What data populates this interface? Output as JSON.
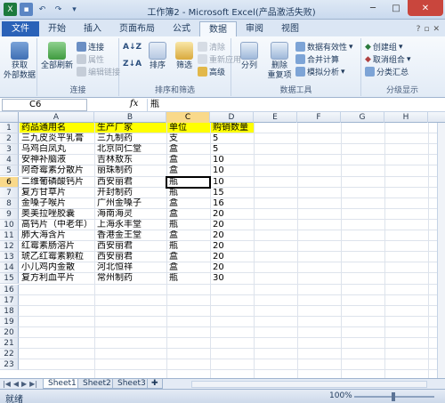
{
  "window": {
    "title": "工作簿2 - Microsoft Excel(产品激活失败)"
  },
  "tabs": [
    {
      "label": "文件"
    },
    {
      "label": "开始"
    },
    {
      "label": "插入"
    },
    {
      "label": "页面布局"
    },
    {
      "label": "公式"
    },
    {
      "label": "数据"
    },
    {
      "label": "审阅"
    },
    {
      "label": "视图"
    }
  ],
  "ribbon": {
    "get_external": "获取\n外部数据",
    "refresh_all": "全部刷新",
    "connections": "连接",
    "properties": "属性",
    "edit_links": "编辑链接",
    "group_connections": "连接",
    "sort_az": "A↓Z",
    "sort_za": "Z↓A",
    "sort": "排序",
    "filter": "筛选",
    "clear": "清除",
    "reapply": "重新应用",
    "advanced": "高级",
    "group_sort": "排序和筛选",
    "text_to_columns": "分列",
    "remove_dupes": "删除\n重复项",
    "data_validation": "数据有效性",
    "consolidate": "合并计算",
    "what_if": "模拟分析",
    "group_tools": "数据工具",
    "group_create": "创建组",
    "ungroup": "取消组合",
    "subtotal": "分类汇总",
    "group_outline": "分级显示"
  },
  "formula_bar": {
    "name_box": "C6",
    "fx": "fx",
    "formula": "瓶"
  },
  "columns": [
    "A",
    "B",
    "C",
    "D",
    "E",
    "F",
    "G",
    "H"
  ],
  "rows": [
    "1",
    "2",
    "3",
    "4",
    "5",
    "6",
    "7",
    "8",
    "9",
    "10",
    "11",
    "12",
    "13",
    "14",
    "15",
    "16",
    "17",
    "18",
    "19",
    "20",
    "21",
    "22",
    "23"
  ],
  "sheet": {
    "header": [
      "药品通用名",
      "生产厂家",
      "单位",
      "购销数量"
    ],
    "data": [
      [
        "三九皮炎平乳膏",
        "三九制药",
        "支",
        "5"
      ],
      [
        "乌鸡白凤丸",
        "北京同仁堂",
        "盒",
        "5"
      ],
      [
        "安神补脑液",
        "吉林敖东",
        "盒",
        "10"
      ],
      [
        "阿奇霉素分散片",
        "丽珠制药",
        "盒",
        "10"
      ],
      [
        "二维葡磷酸钙片",
        "西安丽君",
        "瓶",
        "10"
      ],
      [
        "复方甘草片",
        "开封制药",
        "瓶",
        "15"
      ],
      [
        "金嗓子喉片",
        "广州金嗓子",
        "盒",
        "16"
      ],
      [
        "奥美拉唑胶囊",
        "海南海灵",
        "盒",
        "20"
      ],
      [
        "高钙片（中老年）",
        "上海永丰堂",
        "瓶",
        "20"
      ],
      [
        "肺大海含片",
        "香港金王堂",
        "盒",
        "20"
      ],
      [
        "红霉素肠溶片",
        "西安丽君",
        "瓶",
        "20"
      ],
      [
        "琥乙红霉素颗粒",
        "西安丽君",
        "盒",
        "20"
      ],
      [
        "小儿鸡内金散",
        "河北恒祥",
        "盒",
        "20"
      ],
      [
        "复方利血平片",
        "常州制药",
        "瓶",
        "30"
      ]
    ]
  },
  "sheets": [
    "Sheet1",
    "Sheet2",
    "Sheet3"
  ],
  "status": {
    "left": "就绪",
    "zoom": "100%"
  },
  "colors": {
    "header_fill": "#ffff00",
    "file_tab": "#2a62b8",
    "close_btn": "#c9463d"
  }
}
